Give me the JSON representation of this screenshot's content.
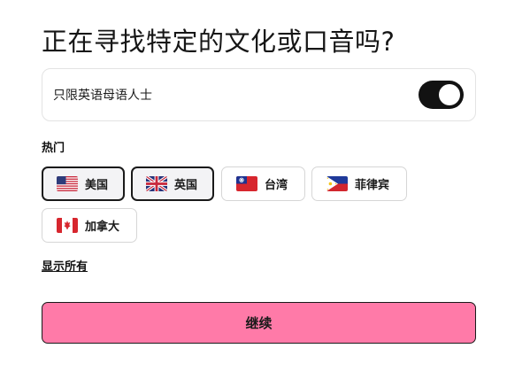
{
  "title": "正在寻找特定的文化或口音吗?",
  "native_only": {
    "label": "只限英语母语人士",
    "toggle_on": true
  },
  "popular": {
    "label": "热门",
    "chips": [
      {
        "label": "美国",
        "flag": "us-flag-icon",
        "selected": true
      },
      {
        "label": "英国",
        "flag": "uk-flag-icon",
        "selected": true
      },
      {
        "label": "台湾",
        "flag": "taiwan-flag-icon",
        "selected": false
      },
      {
        "label": "菲律宾",
        "flag": "philippines-flag-icon",
        "selected": false
      },
      {
        "label": "加拿大",
        "flag": "canada-flag-icon",
        "selected": false
      }
    ]
  },
  "show_all_label": "显示所有",
  "continue_label": "继续",
  "colors": {
    "accent": "#ff7aa8",
    "toggle": "#121212"
  }
}
